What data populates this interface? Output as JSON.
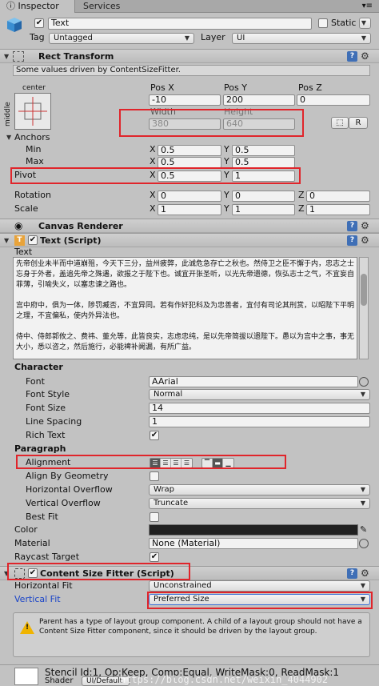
{
  "tabs": {
    "inspector": "Inspector",
    "services": "Services",
    "menu": "▾≡"
  },
  "object": {
    "name": "Text",
    "static_label": "Static",
    "tag_label": "Tag",
    "tag_value": "Untagged",
    "layer_label": "Layer",
    "layer_value": "UI"
  },
  "rect": {
    "title": "Rect Transform",
    "driven_note": "Some values driven by ContentSizeFitter.",
    "anchor_h": "center",
    "anchor_v": "middle",
    "posx_label": "Pos X",
    "posy_label": "Pos Y",
    "posz_label": "Pos Z",
    "posx": "-10",
    "posy": "200",
    "posz": "0",
    "width_label": "Width",
    "height_label": "Height",
    "width": "380",
    "height": "640",
    "btn_r": "R",
    "btn_blueprint": "⬚",
    "anchors_label": "Anchors",
    "min_label": "Min",
    "max_label": "Max",
    "pivot_label": "Pivot",
    "min_x": "0.5",
    "min_y": "0.5",
    "max_x": "0.5",
    "max_y": "0.5",
    "pivot_x": "0.5",
    "pivot_y": "1",
    "rotation_label": "Rotation",
    "rot_x": "0",
    "rot_y": "0",
    "rot_z": "0",
    "scale_label": "Scale",
    "scale_x": "1",
    "scale_y": "1",
    "scale_z": "1",
    "x": "X",
    "y": "Y",
    "z": "Z"
  },
  "canvas_renderer": {
    "title": "Canvas Renderer"
  },
  "text_script": {
    "title": "Text (Script)",
    "text_label": "Text",
    "paragraphs": [
      "先帝创业未半而中道崩殂，今天下三分，益州疲弊，此诚危急存亡之秋也。然侍卫之臣不懈于内，忠志之士忘身于外者，盖追先帝之殊遇，欲报之于陛下也。诚宜开张圣听，以光先帝遗德，恢弘志士之气，不宜妄自菲薄，引喻失义，以塞忠谏之路也。",
      "宫中府中，俱为一体，陟罚臧否，不宜异同。若有作奸犯科及为忠善者，宜付有司论其刑赏，以昭陛下平明之理，不宜偏私，使内外异法也。",
      "侍中、侍郎郭攸之、费祎、董允等，此皆良实，志虑忠纯，是以先帝简拔以遗陛下。愚以为宫中之事，事无大小，悉以咨之，然后施行，必能裨补阙漏，有所广益。"
    ],
    "character_label": "Character",
    "font_label": "Font",
    "font_value": "Arial",
    "font_style_label": "Font Style",
    "font_style_value": "Normal",
    "font_size_label": "Font Size",
    "font_size_value": "14",
    "line_spacing_label": "Line Spacing",
    "line_spacing_value": "1",
    "rich_text_label": "Rich Text",
    "paragraph_label": "Paragraph",
    "alignment_label": "Alignment",
    "align_geometry_label": "Align By Geometry",
    "h_overflow_label": "Horizontal Overflow",
    "h_overflow_value": "Wrap",
    "v_overflow_label": "Vertical Overflow",
    "v_overflow_value": "Truncate",
    "best_fit_label": "Best Fit",
    "color_label": "Color",
    "color_value": "#202020",
    "material_label": "Material",
    "material_value": "None (Material)",
    "raycast_label": "Raycast Target"
  },
  "fitter": {
    "title": "Content Size Fitter (Script)",
    "h_fit_label": "Horizontal Fit",
    "h_fit_value": "Unconstrained",
    "v_fit_label": "Vertical Fit",
    "v_fit_value": "Preferred Size",
    "warning": "Parent has a type of layout group component. A child of a layout group should not have a Content Size Fitter component, since it should be driven by the layout group."
  },
  "material_info": {
    "stencil": "Stencil Id:1, Op:Keep, Comp:Equal, WriteMask:0, ReadMask:1",
    "shader_label": "Shader",
    "shader_value": "UI/Default",
    "watermark": "https://blog.csdn.net/weixin_4044902"
  },
  "colors": {
    "red_highlight": "#e0252b",
    "blue_label": "#1a44c8",
    "warn": "#f0b400"
  }
}
